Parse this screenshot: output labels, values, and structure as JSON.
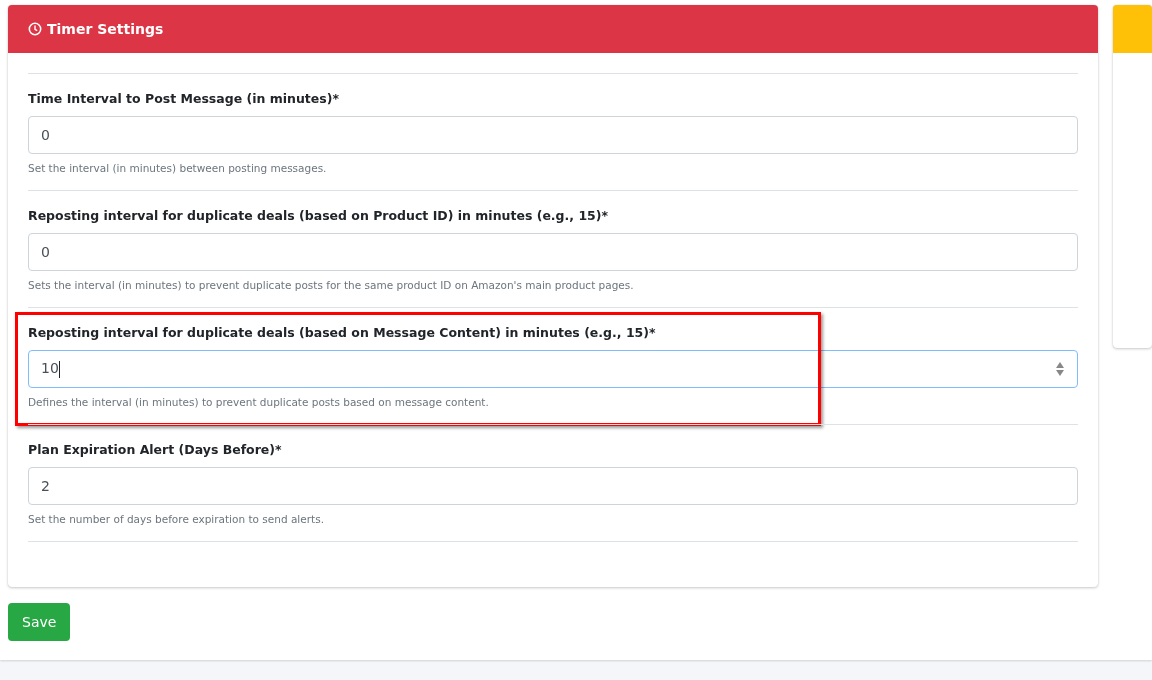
{
  "card": {
    "title": "Timer Settings"
  },
  "fields": [
    {
      "label": "Time Interval to Post Message (in minutes)*",
      "value": "0",
      "help": "Set the interval (in minutes) between posting messages.",
      "focused": false,
      "highlighted": false
    },
    {
      "label": "Reposting interval for duplicate deals (based on Product ID) in minutes (e.g., 15)*",
      "value": "0",
      "help": "Sets the interval (in minutes) to prevent duplicate posts for the same product ID on Amazon's main product pages.",
      "focused": false,
      "highlighted": false
    },
    {
      "label": "Reposting interval for duplicate deals (based on Message Content) in minutes (e.g., 15)*",
      "value": "10",
      "help": "Defines the interval (in minutes) to prevent duplicate posts based on message content.",
      "focused": true,
      "highlighted": true
    },
    {
      "label": "Plan Expiration Alert (Days Before)*",
      "value": "2",
      "help": "Set the number of days before expiration to send alerts.",
      "focused": false,
      "highlighted": false
    }
  ],
  "save_button": "Save"
}
